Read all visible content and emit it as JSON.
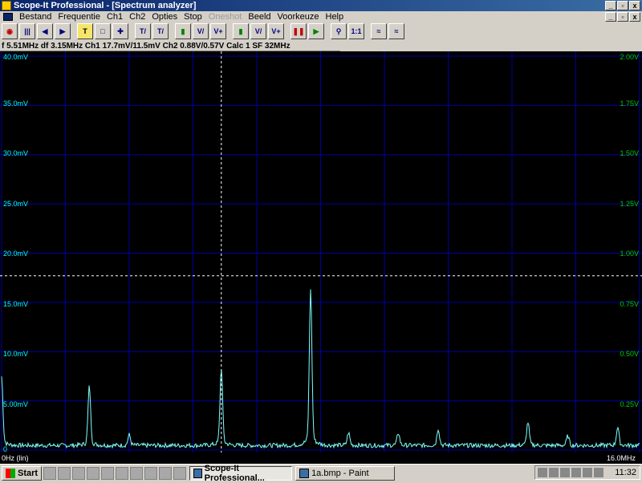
{
  "window": {
    "title": "Scope-It Professional - [Spectrum analyzer]"
  },
  "menu": {
    "items": [
      {
        "label": "Bestand",
        "disabled": false
      },
      {
        "label": "Frequentie",
        "disabled": false
      },
      {
        "label": "Ch1",
        "disabled": false
      },
      {
        "label": "Ch2",
        "disabled": false
      },
      {
        "label": "Opties",
        "disabled": false
      },
      {
        "label": "Stop",
        "disabled": false
      },
      {
        "label": "Oneshot",
        "disabled": true
      },
      {
        "label": "Beeld",
        "disabled": false
      },
      {
        "label": "Voorkeuze",
        "disabled": false
      },
      {
        "label": "Help",
        "disabled": false
      }
    ]
  },
  "status": {
    "text": "f  5.51MHz  df  3.15MHz Ch1   17.7mV/11.5mV  Ch2     0.88V/0.57V  Calc    1  SF    32MHz"
  },
  "plot": {
    "left_labels": [
      "40.0mV",
      "35.0mV",
      "30.0mV",
      "25.0mV",
      "20.0mV",
      "15.0mV",
      "10.0mV",
      "5.00mV",
      "0"
    ],
    "right_labels": [
      "2.00V",
      "1.75V",
      "1.50V",
      "1.25V",
      "1.00V",
      "0.75V",
      "0.50V",
      "0.25V"
    ],
    "x_left_label": "0Hz (lin)",
    "x_right_label": "16.0MHz",
    "trace_color": "#7fffff",
    "cursor_color": "#ffffff",
    "grid_color": "#0000a0",
    "peaks_mhz": [
      0.0,
      2.2,
      3.2,
      5.51,
      7.75,
      8.7,
      9.95,
      10.95,
      13.2,
      14.2,
      15.45
    ],
    "peaks_mv": [
      6.5,
      5.6,
      1.0,
      7.3,
      14.8,
      1.2,
      1.2,
      1.6,
      2.2,
      0.9,
      1.7
    ]
  },
  "taskbar": {
    "start_label": "Start",
    "items": [
      {
        "label": "Scope-It Professional...",
        "active": true
      },
      {
        "label": "1a.bmp - Paint",
        "active": false
      }
    ],
    "clock": "11:32"
  }
}
